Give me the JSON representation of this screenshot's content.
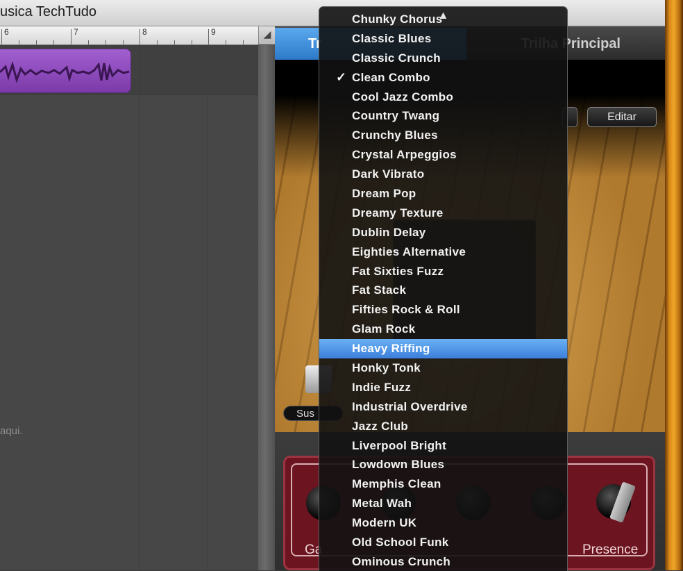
{
  "window": {
    "title": "usica TechTudo"
  },
  "ruler": {
    "marks": [
      "6",
      "7",
      "8",
      "9"
    ]
  },
  "tracks": {
    "hint_text": "aqui."
  },
  "tabs": {
    "left": "Tr",
    "right": "Trilha Principal"
  },
  "toolbar": {
    "edit_label": "Editar"
  },
  "stage": {
    "sustain_label": "Sus"
  },
  "amp": {
    "presence_label": "Presence",
    "gain_label": "Ga"
  },
  "menu": {
    "scroll_up_icon": "triangle-up",
    "checked_item": "Clean Combo",
    "selected_item": "Heavy Riffing",
    "items": [
      "Chunky Chorus",
      "Classic Blues",
      "Classic Crunch",
      "Clean Combo",
      "Cool Jazz Combo",
      "Country Twang",
      "Crunchy Blues",
      "Crystal Arpeggios",
      "Dark Vibrato",
      "Dream Pop",
      "Dreamy Texture",
      "Dublin Delay",
      "Eighties Alternative",
      "Fat Sixties Fuzz",
      "Fat Stack",
      "Fifties Rock & Roll",
      "Glam Rock",
      "Heavy Riffing",
      "Honky Tonk",
      "Indie Fuzz",
      "Industrial Overdrive",
      "Jazz Club",
      "Liverpool Bright",
      "Lowdown Blues",
      "Memphis Clean",
      "Metal Wah",
      "Modern UK",
      "Old School Funk",
      "Ominous Crunch"
    ]
  },
  "colors": {
    "selection": "#3b7fdc",
    "region": "#8e46bd",
    "tab_active": "#2d79c8"
  }
}
